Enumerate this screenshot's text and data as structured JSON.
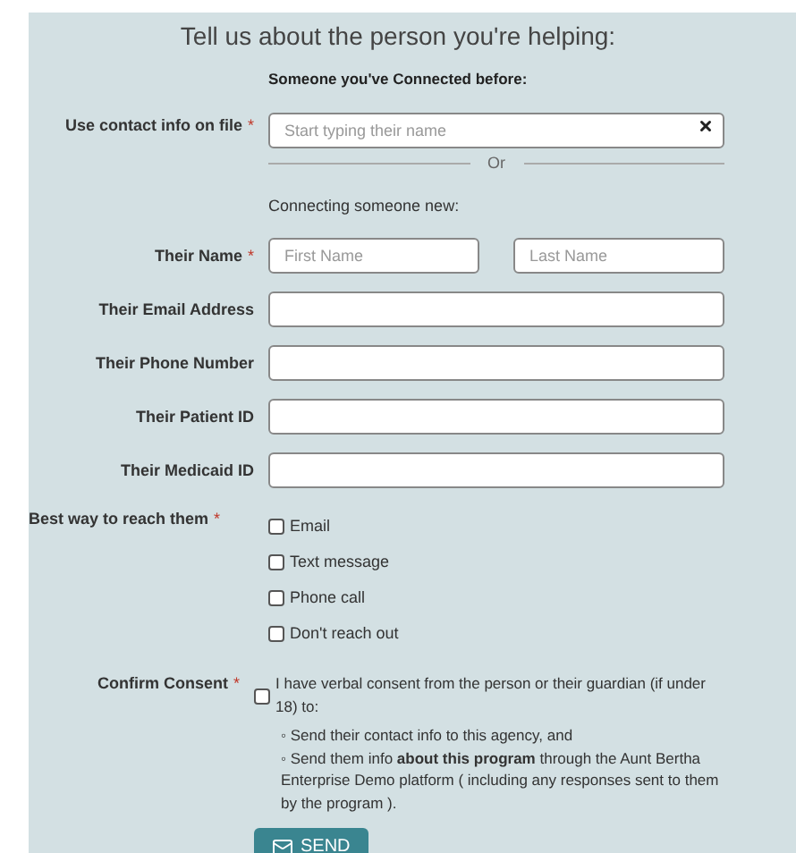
{
  "title": "Tell us about the person you're helping:",
  "required_mark": "*",
  "existing": {
    "heading": "Someone you've Connected before:",
    "label": "Use contact info on file",
    "required": true,
    "placeholder": "Start typing their name"
  },
  "divider": "Or",
  "new_heading": "Connecting someone new:",
  "fields": [
    {
      "label": "Their Name",
      "required": true,
      "kind": "name",
      "placeholders": [
        "First Name",
        "Last Name"
      ]
    },
    {
      "label": "Their Email Address",
      "required": false,
      "kind": "text"
    },
    {
      "label": "Their Phone Number",
      "required": false,
      "kind": "text"
    },
    {
      "label": "Their Patient ID",
      "required": false,
      "kind": "text"
    },
    {
      "label": "Their Medicaid ID",
      "required": false,
      "kind": "text"
    }
  ],
  "contact_method": {
    "label": "Best way to reach them",
    "required": true,
    "options": [
      {
        "label": "Email",
        "checked": false
      },
      {
        "label": "Text message",
        "checked": false
      },
      {
        "label": "Phone call",
        "checked": false
      },
      {
        "label": "Don't reach out",
        "checked": false
      }
    ]
  },
  "consent": {
    "label": "Confirm Consent",
    "required": true,
    "checked": false,
    "text": "I have verbal consent from the person or their guardian (if under 18) to:",
    "bullets": [
      "◦ Send their contact info to this agency, and",
      "◦ Send them info **about this program** through the Aunt Bertha Enterprise Demo platform ( including any responses sent to them by the program )."
    ]
  },
  "send_button": "SEND"
}
